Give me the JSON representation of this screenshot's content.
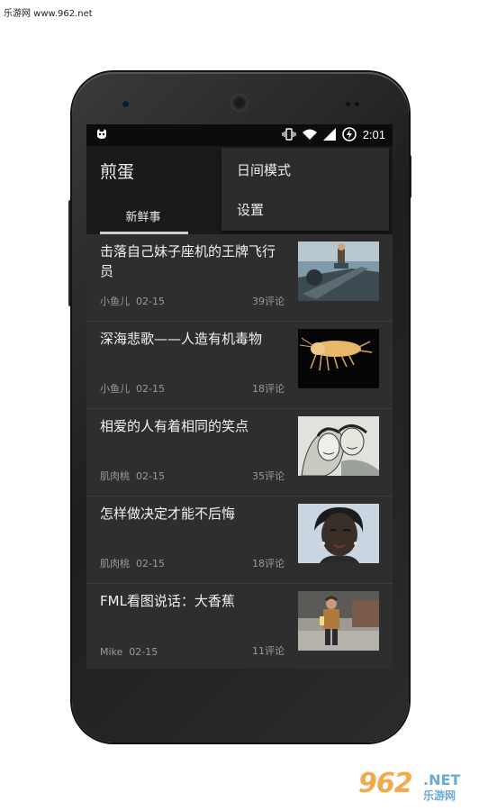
{
  "watermark_top": "乐游网 www.962.net",
  "watermark_bottom": {
    "big": "962",
    "net": ".NET",
    "sub": "乐游网"
  },
  "status_bar": {
    "time": "2:01",
    "icons": [
      "vibrate-icon",
      "wifi-icon",
      "cell-signal-icon",
      "battery-charging-icon"
    ]
  },
  "app": {
    "title": "煎蛋",
    "tab_label": "新鲜事"
  },
  "menu": {
    "items": [
      "日间模式",
      "设置"
    ]
  },
  "list": [
    {
      "title": "击落自己妹子座机的王牌飞行员",
      "author": "小鱼儿",
      "date": "02-15",
      "comments": "39评论",
      "thumb": "pilot-airplane-image"
    },
    {
      "title": "深海悲歌——人造有机毒物",
      "author": "小鱼儿",
      "date": "02-15",
      "comments": "18评论",
      "thumb": "deep-sea-amphipod-image"
    },
    {
      "title": "相爱的人有着相同的笑点",
      "author": "肌肉桃",
      "date": "02-15",
      "comments": "35评论",
      "thumb": "couple-sketch-image"
    },
    {
      "title": "怎样做决定才能不后悔",
      "author": "肌肉桃",
      "date": "02-15",
      "comments": "18评论",
      "thumb": "woman-portrait-image"
    },
    {
      "title": "FML看图说话：大香蕉",
      "author": "Mike",
      "date": "02-15",
      "comments": "11评论",
      "thumb": "man-standing-image"
    }
  ]
}
